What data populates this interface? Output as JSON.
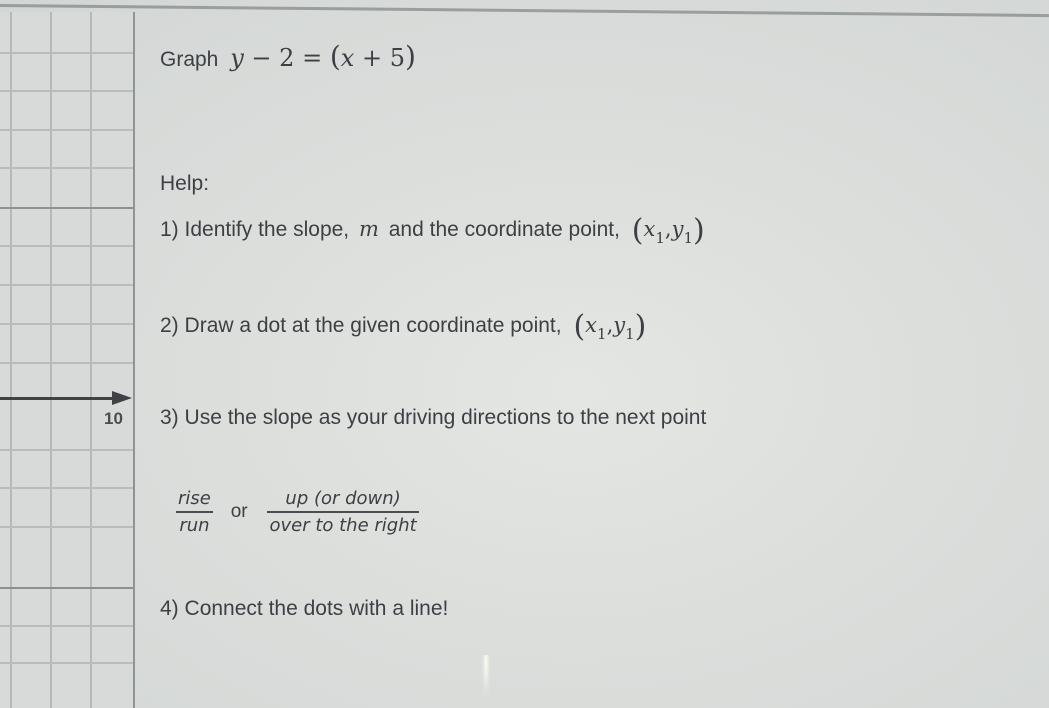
{
  "problem": {
    "prefix": "Graph",
    "equation": {
      "lhs_var": "y",
      "lhs_op": "−",
      "lhs_const": "2",
      "eq": "=",
      "open": "(",
      "rhs_var": "x",
      "rhs_op": "+",
      "rhs_const": "5",
      "close": ")"
    }
  },
  "help": {
    "heading": "Help:",
    "steps": [
      {
        "number": "1)",
        "text_before": "Identify the slope,",
        "slope_var": "m",
        "text_after": "and the coordinate point,",
        "point": {
          "x": "x",
          "x_sub": "1",
          "sep": ",",
          "y": "y",
          "y_sub": "1"
        }
      },
      {
        "number": "2)",
        "text": "Draw a dot at the given coordinate point,",
        "point": {
          "x": "x",
          "x_sub": "1",
          "sep": ",",
          "y": "y",
          "y_sub": "1"
        }
      },
      {
        "number": "3)",
        "text": "Use the slope as your driving directions to the next point"
      },
      {
        "number": "4)",
        "text": "Connect the dots with a line!"
      }
    ],
    "fraction_rise_run": {
      "numerator": "rise",
      "denominator": "run"
    },
    "fraction_joiner": "or",
    "fraction_directions": {
      "numerator": "up (or down)",
      "denominator": "over to the right"
    }
  },
  "graph_panel": {
    "axis_label": "10"
  },
  "paren_open": "(",
  "paren_close": ")"
}
